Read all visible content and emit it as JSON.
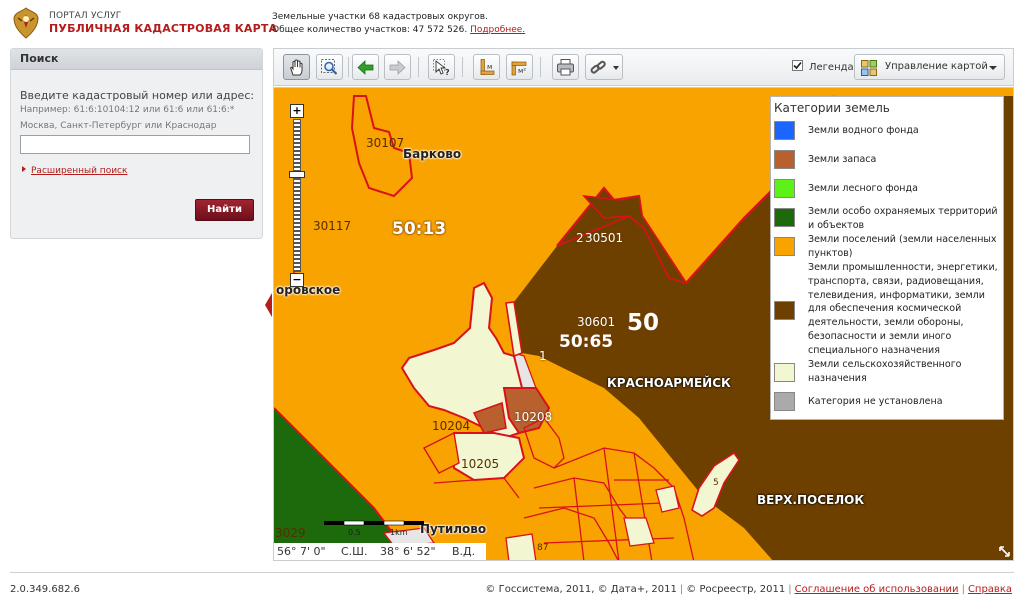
{
  "header": {
    "portal_label": "ПОРТАЛ УСЛУГ",
    "map_title": "ПУБЛИЧНАЯ КАДАСТРОВАЯ КАРТА",
    "stats_line1": "Земельные участки 68 кадастровых округов.",
    "stats_line2": "Общее количество участков: 47 572 526.",
    "more_link": "Подробнее.",
    "logo_icon": "coat-of-arms-icon"
  },
  "search": {
    "title": "Поиск",
    "prompt": "Введите кадастровый номер или адрес:",
    "example_line1": "Например: 61:6:10104:12 или 61:6 или 61:6:*",
    "example_line2": "Москва, Санкт-Петербург или Краснодар",
    "input_value": "",
    "advanced_link": "Расширенный поиск",
    "find_button": "Найти"
  },
  "toolbar": {
    "tools": [
      {
        "name": "pan-hand-icon",
        "active": true
      },
      {
        "name": "zoom-area-icon"
      },
      {
        "name": "back-arrow-icon"
      },
      {
        "name": "forward-arrow-icon"
      },
      {
        "name": "identify-icon"
      },
      {
        "name": "measure-length-icon"
      },
      {
        "name": "measure-area-icon"
      },
      {
        "name": "print-icon"
      },
      {
        "name": "link-icon"
      }
    ],
    "legend_checkbox_label": "Легенда",
    "legend_checked": true,
    "map_management_label": "Управление картой"
  },
  "legend": {
    "title": "Категории земель",
    "items": [
      {
        "label": "Земли водного фонда",
        "color": "#1b66ff"
      },
      {
        "label": "Земли запаса",
        "color": "#b8612f"
      },
      {
        "label": "Земли лесного фонда",
        "color": "#5cf218"
      },
      {
        "label": "Земли особо охраняемых территорий и объектов",
        "color": "#1c6a0c"
      },
      {
        "label": "Земли поселений (земли населенных пунктов)",
        "color": "#f9a300"
      },
      {
        "label": "Земли промышленности, энергетики, транспорта, связи, радиовещания, телевидения, информатики, земли для обеспечения космической деятельности, земли обороны, безопасности и земли иного специального назначения",
        "color": "#6d4000"
      },
      {
        "label": "Земли сельскохозяйственного назначения",
        "color": "#f3f7d1"
      },
      {
        "label": "Категория не установлена",
        "color": "#aaaaaa"
      }
    ]
  },
  "map": {
    "parcels": [
      "30107",
      "30117",
      "30501",
      "30601",
      "10208",
      "10204",
      "10205",
      "3029"
    ],
    "cadastral_districts": [
      "50:13",
      "50:65",
      "50"
    ],
    "places": [
      "Барково",
      "оровское",
      "КРАСНОАРМЕЙСК",
      "ВЕРХ.ПОСЕЛОК",
      "Путилово"
    ],
    "small_numbers": [
      "2",
      "1",
      "5",
      "87"
    ],
    "scale_start": "0.5",
    "scale_end": "1km",
    "latitude": "56° 7' 0\"",
    "lat_dir": "С.Ш.",
    "longitude": "38° 6' 52\"",
    "lon_dir": "В.Д."
  },
  "footer": {
    "version": "2.0.349.682.6",
    "copyright": "© Госсистема, 2011, © Дата+, 2011",
    "copyright2": "© Росреестр, 2011",
    "terms_link": "Соглашение об использовании",
    "help_link": "Справка"
  }
}
